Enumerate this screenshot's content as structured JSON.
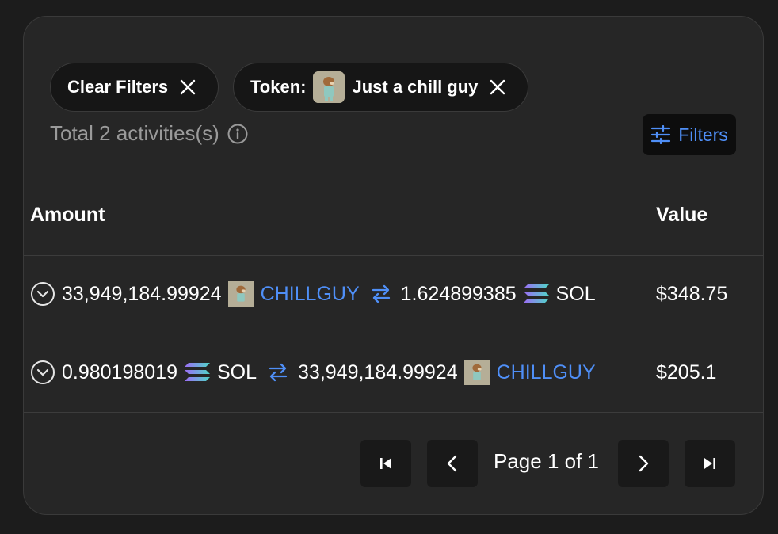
{
  "filters": {
    "clear_label": "Clear Filters",
    "token_prefix": "Token:",
    "token_name": "Just a chill guy"
  },
  "summary": {
    "total_text": "Total 2 activities(s)",
    "filters_button_label": "Filters"
  },
  "table": {
    "headers": {
      "amount": "Amount",
      "value": "Value"
    },
    "rows": [
      {
        "from_amount": "33,949,184.99924",
        "from_symbol": "CHILLGUY",
        "to_amount": "1.624899385",
        "to_symbol": "SOL",
        "value": "$348.75"
      },
      {
        "from_amount": "0.980198019",
        "from_symbol": "SOL",
        "to_amount": "33,949,184.99924",
        "to_symbol": "CHILLGUY",
        "value": "$205.1"
      }
    ]
  },
  "pagination": {
    "page_text": "Page 1 of 1"
  },
  "colors": {
    "accent": "#4f8ff7",
    "card_bg": "#262626",
    "page_bg": "#1c1c1c",
    "muted_text": "#9a9a9a"
  },
  "icons": {
    "chip_close": "close-icon",
    "info": "info-icon",
    "filters": "sliders-icon",
    "expand": "chevron-down-circle-icon",
    "swap": "swap-arrows-icon",
    "sol": "solana-logo-icon",
    "token": "chillguy-token-icon",
    "first_page": "first-page-icon",
    "prev_page": "chevron-left-icon",
    "next_page": "chevron-right-icon",
    "last_page": "last-page-icon"
  }
}
